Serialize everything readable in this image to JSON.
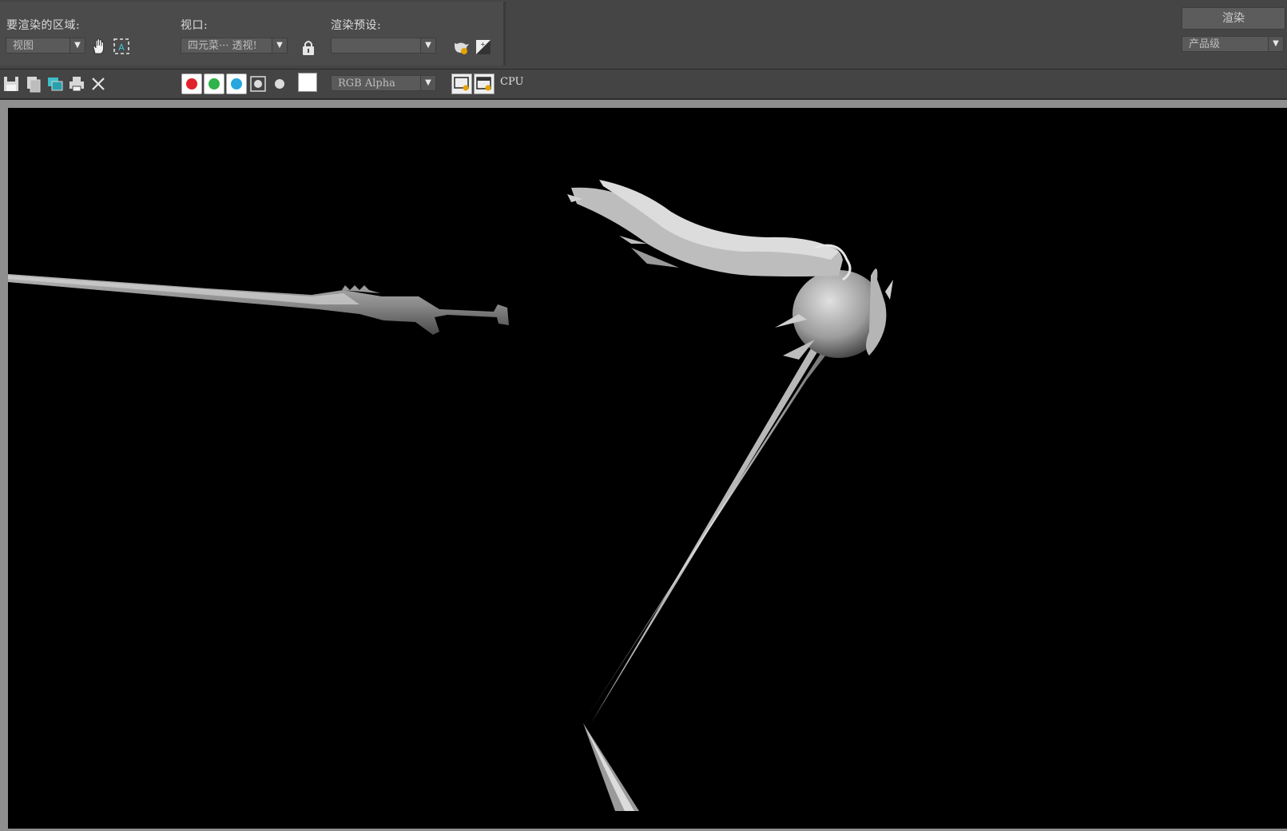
{
  "top": {
    "area_label": "要渲染的区域:",
    "area_value": "视图",
    "viewport_label": "视口:",
    "viewport_value": "四元菜··· 透视!",
    "preset_label": "渲染预设:",
    "preset_value": "",
    "render_button": "渲染",
    "quality_value": "产品级"
  },
  "toolbar": {
    "channel_value": "RGB Alpha",
    "cpu_label": "CPU",
    "channel_colors": [
      "#e2222b",
      "#2fb34a",
      "#27a7e0"
    ]
  },
  "icons": {
    "hand": "pan-hand-icon",
    "region": "auto-region-icon",
    "lock": "lock-icon",
    "teapot": "environment-teapot-icon",
    "exposure": "exposure-icon",
    "save": "save-icon",
    "copy": "copy-icon",
    "clone": "clone-window-icon",
    "print": "print-icon",
    "clear": "clear-icon"
  }
}
